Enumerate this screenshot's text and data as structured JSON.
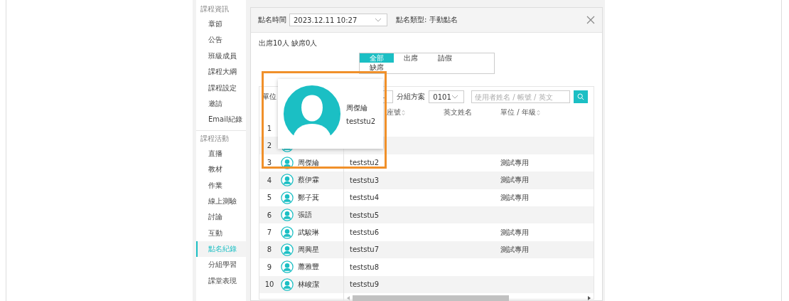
{
  "sidebar": {
    "sections": [
      {
        "title": "課程資訊",
        "items": [
          {
            "label": "章節",
            "selected": false
          },
          {
            "label": "公告",
            "selected": false
          },
          {
            "label": "班級成員",
            "selected": false
          },
          {
            "label": "課程大綱",
            "selected": false
          },
          {
            "label": "課程設定",
            "selected": false
          },
          {
            "label": "邀請",
            "selected": false
          },
          {
            "label": "Email紀錄",
            "selected": false
          }
        ]
      },
      {
        "title": "課程活動",
        "items": [
          {
            "label": "直播",
            "selected": false
          },
          {
            "label": "教材",
            "selected": false
          },
          {
            "label": "作業",
            "selected": false
          },
          {
            "label": "線上測驗",
            "selected": false
          },
          {
            "label": "討論",
            "selected": false
          },
          {
            "label": "互動",
            "selected": false
          },
          {
            "label": "點名紀錄",
            "selected": true
          },
          {
            "label": "分組學習",
            "selected": false
          },
          {
            "label": "課堂表現",
            "selected": false
          }
        ]
      }
    ]
  },
  "dialog": {
    "time_label": "點名時間",
    "time_value": "2023.12.11 10:27",
    "type_text": "點名類型: 手動點名",
    "summary": "出席10人 缺席0人",
    "tabs": [
      {
        "label": "全部",
        "selected": true
      },
      {
        "label": "出席",
        "selected": false
      },
      {
        "label": "請假",
        "selected": false
      },
      {
        "label": "缺席",
        "selected": false
      }
    ],
    "filters": {
      "unit_label": "單位",
      "group_label": "分組方案",
      "group_value": "0101",
      "search_placeholder": "使用者姓名 / 帳號 / 英文"
    },
    "columns": [
      {
        "label": "座號",
        "sortable": true
      },
      {
        "label": "英文姓名",
        "sortable": false
      },
      {
        "label": "單位 / 年級",
        "sortable": true
      }
    ],
    "rows": [
      {
        "no": "1"
      },
      {
        "no": "2"
      },
      {
        "no": "3",
        "name": "周傑綸",
        "account": "teststu2",
        "unit": "測試專用"
      },
      {
        "no": "4",
        "name": "蔡伊霖",
        "account": "teststu3",
        "unit": "測試專用"
      },
      {
        "no": "5",
        "name": "鄭子萁",
        "account": "teststu4",
        "unit": "測試專用"
      },
      {
        "no": "6",
        "name": "張語",
        "account": "teststu5"
      },
      {
        "no": "7",
        "name": "武駿琳",
        "account": "teststu6",
        "unit": "測試專用"
      },
      {
        "no": "8",
        "name": "周興星",
        "account": "teststu7",
        "unit": "測試專用"
      },
      {
        "no": "9",
        "name": "蕭雅豐",
        "account": "teststu8"
      },
      {
        "no": "10",
        "name": "林峻潔",
        "account": "teststu9"
      }
    ],
    "popover": {
      "name": "周傑綸",
      "account": "teststu2"
    }
  }
}
